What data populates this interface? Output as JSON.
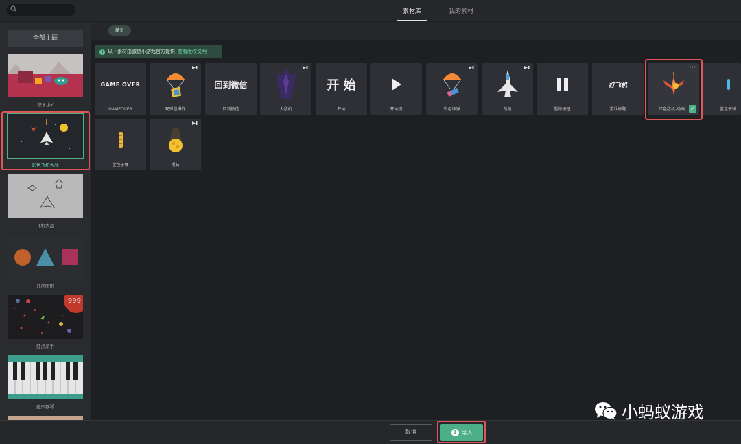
{
  "header": {
    "search_placeholder": "",
    "tabs": [
      {
        "label": "素材库",
        "active": true
      },
      {
        "label": "我的素材",
        "active": false
      }
    ]
  },
  "sidebar": {
    "all_label": "全部主题",
    "themes": [
      {
        "label": "积木小Y"
      },
      {
        "label": "彩色飞机大战",
        "selected": true
      },
      {
        "label": "飞机大战"
      },
      {
        "label": "几何图形"
      },
      {
        "label": "红点杀手"
      },
      {
        "label": "魔声钢琴"
      }
    ],
    "red_dot_badge": "999"
  },
  "filter": {
    "chip_label": "精灵"
  },
  "notice": {
    "text": "以下素材由微信小游戏官方提供",
    "link": "查看版权说明"
  },
  "cards": [
    {
      "label": "GAMEOVER",
      "art_text": "GAME OVER"
    },
    {
      "label": "双弹包爆炸"
    },
    {
      "label": "回到微信",
      "art_text": "回到微信"
    },
    {
      "label": "大敌机"
    },
    {
      "label": "开始",
      "art_text": "开 始"
    },
    {
      "label": "开始键"
    },
    {
      "label": "彩色炸弹"
    },
    {
      "label": "战机"
    },
    {
      "label": "暂停按钮"
    },
    {
      "label": "游戏标题",
      "art_text": "打飞机"
    },
    {
      "label": "红色敌机-动画",
      "selected": true
    },
    {
      "label": "蓝色子弹"
    },
    {
      "label": "金色子弹"
    },
    {
      "label": "陨石"
    }
  ],
  "footer": {
    "cancel_label": "取消",
    "import_label": "导入",
    "import_count": "1"
  },
  "watermark": {
    "text": "小蚂蚁游戏"
  },
  "colors": {
    "accent": "#4caf88",
    "highlight": "#e05555",
    "background": "#1e1f23"
  }
}
